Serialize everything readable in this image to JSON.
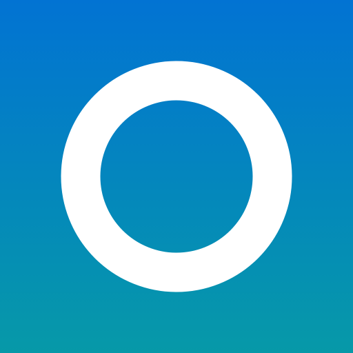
{
  "icon": {
    "name": "ring-icon",
    "colors": {
      "gradient_top": "#0273D3",
      "gradient_bottom": "#0699A8",
      "ring": "#FFFFFF"
    }
  }
}
